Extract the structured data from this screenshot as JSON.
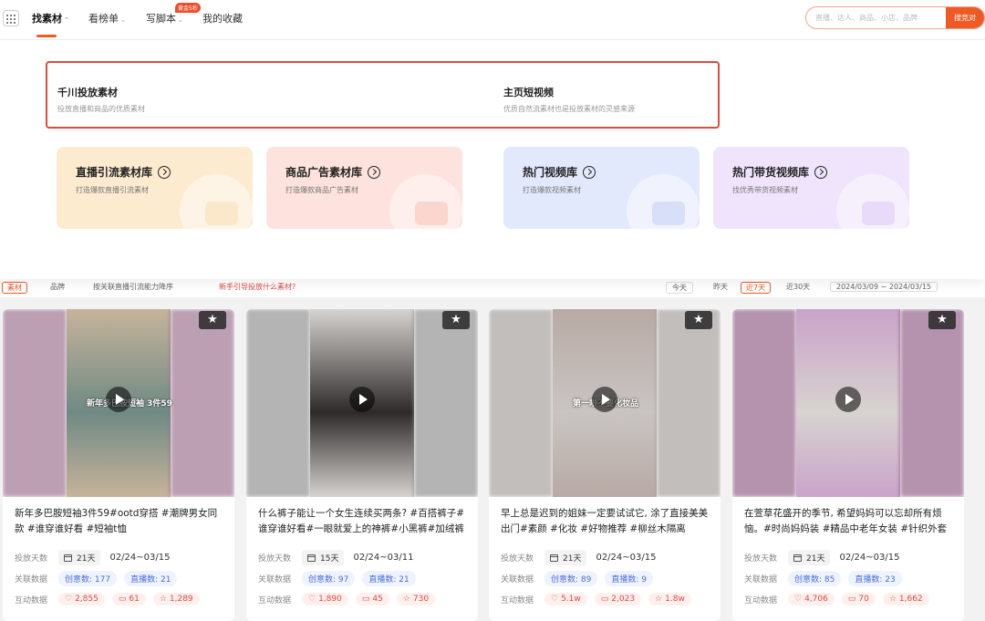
{
  "nav": {
    "items": [
      {
        "label": "找素材",
        "active": true
      },
      {
        "label": "看榜单"
      },
      {
        "label": "写脚本"
      },
      {
        "label": "我的收藏"
      }
    ],
    "badge": "黄金5秒",
    "search_placeholder": "直播、达人、商品、小店、品牌",
    "search_button": "搜竞对"
  },
  "panel": {
    "sections": [
      {
        "title": "千川投放素材",
        "subtitle": "投放直播和商品的优质素材"
      },
      {
        "title": "主页短视频",
        "subtitle": "优质自然流素材也是投放素材的灵感来源"
      }
    ],
    "libraries": [
      {
        "title": "直播引流素材库",
        "subtitle": "打造爆款直播引流素材",
        "color": "#fdebd0",
        "accent": "#f8d6a8"
      },
      {
        "title": "商品广告素材库",
        "subtitle": "打造爆款商品广告素材",
        "color": "#fde2dd",
        "accent": "#f7b8ad"
      },
      {
        "title": "热门视频库",
        "subtitle": "打造爆款视频素材",
        "color": "#e3e9fc",
        "accent": "#b8c8f5"
      },
      {
        "title": "热门带货视频库",
        "subtitle": "找优秀带货视频素材",
        "color": "#efe4fb",
        "accent": "#d6c0f3"
      }
    ]
  },
  "filter": {
    "tab1": "素材",
    "tab2": "品牌",
    "sort": "按关联直播引流能力降序",
    "tip": "新手引导投放什么素材?",
    "today": "今天",
    "yesterday": "昨天",
    "last7": "近7天",
    "last30": "近30天",
    "range": "2024/03/09 ~ 2024/03/15"
  },
  "labels": {
    "days": "投放天数",
    "related": "关联数据",
    "interact": "互动数据"
  },
  "cards": [
    {
      "title": "新年多巴胺短袖3件59#ootd穿搭 #潮牌男女同款 #谁穿谁好看 #短袖t恤",
      "caption": "新年多巴胺短袖 3件59",
      "days": "21天",
      "dates": "02/24~03/15",
      "creative": "创意数: 177",
      "live": "直播数: 21",
      "likes": "2,855",
      "comments": "61",
      "favs": "1,289",
      "colors": [
        "#9a6c8c",
        "#6f8a84",
        "#c7b39b"
      ]
    },
    {
      "title": "什么裤子能让一个女生连续买两条? #百搭裤子#谁穿谁好看#一眼就爱上的神裤#小黑裤#加绒裤#显瘦",
      "caption": "",
      "days": "15天",
      "dates": "02/24~03/11",
      "creative": "创意数: 97",
      "live": "直播数: 21",
      "likes": "1,890",
      "comments": "45",
      "favs": "730",
      "colors": [
        "#8c8c8c",
        "#2e2a2a",
        "#d6d3d0"
      ]
    },
    {
      "title": "早上总是迟到的姐妹一定要试试它, 涂了直接美美出门#素颜 #化妆 #好物推荐 #柳丝木隔离",
      "caption": "第一眼不要化妆品",
      "days": "21天",
      "dates": "02/24~03/15",
      "creative": "创意数: 89",
      "live": "直播数: 9",
      "likes": "5.1w",
      "comments": "2,023",
      "favs": "1.8w",
      "colors": [
        "#a29b97",
        "#c9c4c2",
        "#b8aaa5"
      ]
    },
    {
      "title": "在萱草花盛开的季节, 希望妈妈可以忘却所有烦恼。#时尚妈妈装 #精品中老年女装 #针织外套上衣",
      "caption": "",
      "days": "21天",
      "dates": "02/24~03/15",
      "creative": "创意数: 85",
      "live": "直播数: 23",
      "likes": "4,706",
      "comments": "70",
      "favs": "1,662",
      "colors": [
        "#8e5a84",
        "#d8d3d0",
        "#c9a3c9"
      ]
    }
  ]
}
